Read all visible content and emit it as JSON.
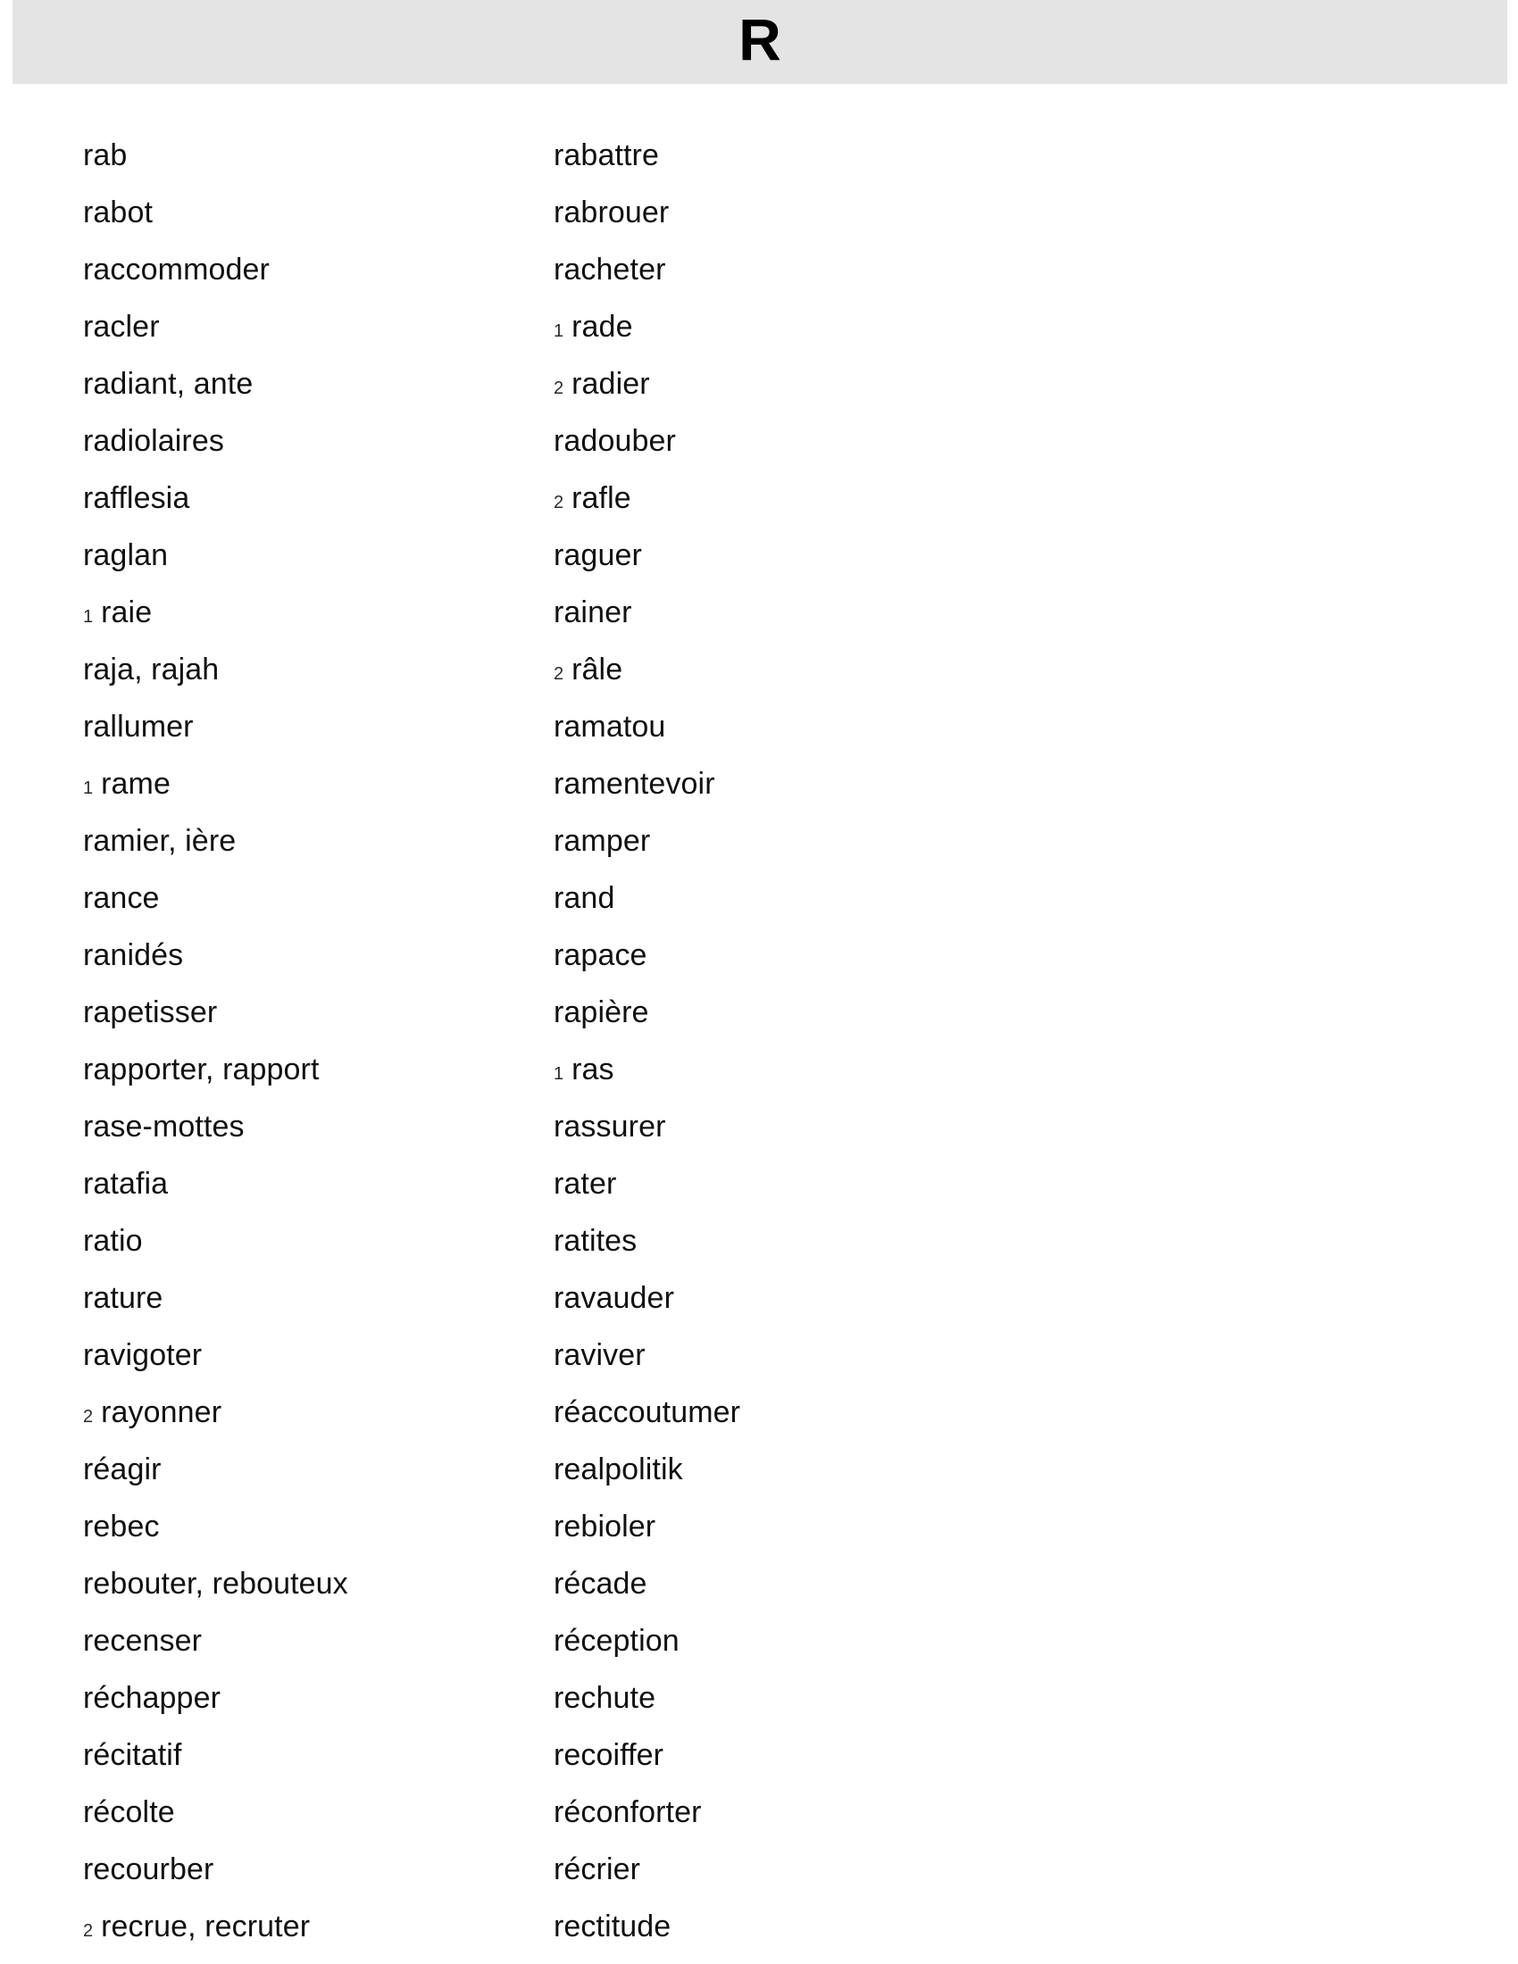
{
  "header": {
    "letter": "R"
  },
  "columns": {
    "left": [
      {
        "num": "",
        "word": "rab"
      },
      {
        "num": "",
        "word": "rabot"
      },
      {
        "num": "",
        "word": "raccommoder"
      },
      {
        "num": "",
        "word": "racler"
      },
      {
        "num": "",
        "word": "radiant, ante"
      },
      {
        "num": "",
        "word": "radiolaires"
      },
      {
        "num": "",
        "word": "rafflesia"
      },
      {
        "num": "",
        "word": "raglan"
      },
      {
        "num": "1",
        "word": "raie"
      },
      {
        "num": "",
        "word": "raja, rajah"
      },
      {
        "num": "",
        "word": "rallumer"
      },
      {
        "num": "1",
        "word": "rame"
      },
      {
        "num": "",
        "word": "ramier, ière"
      },
      {
        "num": "",
        "word": "rance"
      },
      {
        "num": "",
        "word": "ranidés"
      },
      {
        "num": "",
        "word": "rapetisser"
      },
      {
        "num": "",
        "word": "rapporter, rapport"
      },
      {
        "num": "",
        "word": "rase-mottes"
      },
      {
        "num": "",
        "word": "ratafia"
      },
      {
        "num": "",
        "word": "ratio"
      },
      {
        "num": "",
        "word": "rature"
      },
      {
        "num": "",
        "word": "ravigoter"
      },
      {
        "num": "2",
        "word": "rayonner"
      },
      {
        "num": "",
        "word": "réagir"
      },
      {
        "num": "",
        "word": "rebec"
      },
      {
        "num": "",
        "word": "rebouter, rebouteux"
      },
      {
        "num": "",
        "word": "recenser"
      },
      {
        "num": "",
        "word": "réchapper"
      },
      {
        "num": "",
        "word": "récitatif"
      },
      {
        "num": "",
        "word": "récolte"
      },
      {
        "num": "",
        "word": "recourber"
      },
      {
        "num": "2",
        "word": "recrue, recruter"
      }
    ],
    "right": [
      {
        "num": "",
        "word": "rabattre"
      },
      {
        "num": "",
        "word": "rabrouer"
      },
      {
        "num": "",
        "word": "racheter"
      },
      {
        "num": "1",
        "word": "rade"
      },
      {
        "num": "2",
        "word": "radier"
      },
      {
        "num": "",
        "word": "radouber"
      },
      {
        "num": "2",
        "word": "rafle"
      },
      {
        "num": "",
        "word": "raguer"
      },
      {
        "num": "",
        "word": "rainer"
      },
      {
        "num": "2",
        "word": "râle"
      },
      {
        "num": "",
        "word": "ramatou"
      },
      {
        "num": "",
        "word": "ramentevoir"
      },
      {
        "num": "",
        "word": "ramper"
      },
      {
        "num": "",
        "word": "rand"
      },
      {
        "num": "",
        "word": "rapace"
      },
      {
        "num": "",
        "word": "rapière"
      },
      {
        "num": "1",
        "word": "ras"
      },
      {
        "num": "",
        "word": "rassurer"
      },
      {
        "num": "",
        "word": "rater"
      },
      {
        "num": "",
        "word": "ratites"
      },
      {
        "num": "",
        "word": "ravauder"
      },
      {
        "num": "",
        "word": "raviver"
      },
      {
        "num": "",
        "word": "réaccoutumer"
      },
      {
        "num": "",
        "word": "realpolitik"
      },
      {
        "num": "",
        "word": "rebioler"
      },
      {
        "num": "",
        "word": "récade"
      },
      {
        "num": "",
        "word": "réception"
      },
      {
        "num": "",
        "word": "rechute"
      },
      {
        "num": "",
        "word": "recoiffer"
      },
      {
        "num": "",
        "word": "réconforter"
      },
      {
        "num": "",
        "word": "récrier"
      },
      {
        "num": "",
        "word": "rectitude"
      }
    ]
  },
  "colors": {
    "header_background": "#e4e4e4",
    "page_background": "#ffffff",
    "text": "#111111"
  }
}
